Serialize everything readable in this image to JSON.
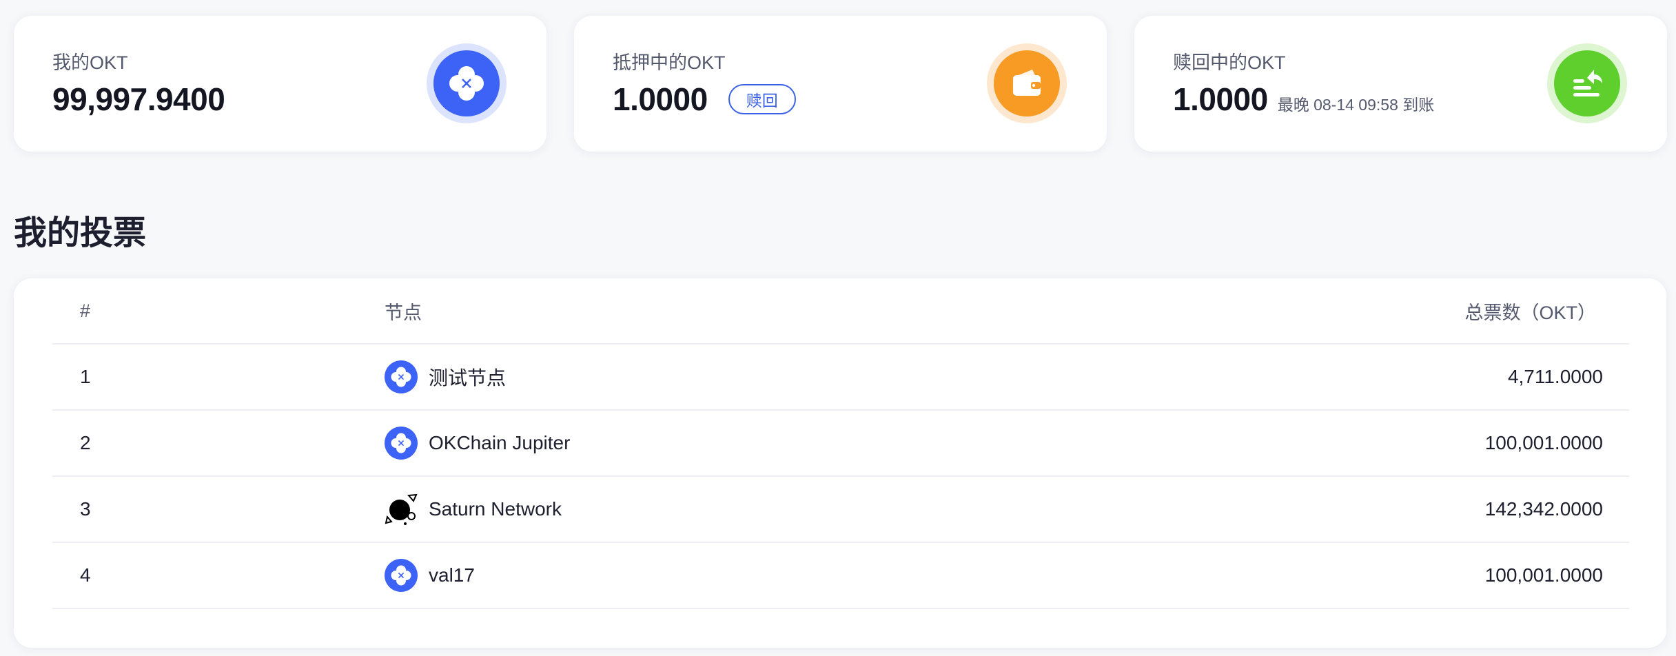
{
  "cards": {
    "my_okt": {
      "label": "我的OKT",
      "value": "99,997.9400",
      "icon": "okt-logo-icon",
      "icon_color": "#3d63f6"
    },
    "staked_okt": {
      "label": "抵押中的OKT",
      "value": "1.0000",
      "redeem_button": "赎回",
      "icon": "wallet-icon",
      "icon_color": "#f79b24"
    },
    "redeeming_okt": {
      "label": "赎回中的OKT",
      "value": "1.0000",
      "arrival_note": "最晚 08-14 09:58 到账",
      "icon": "redeem-return-icon",
      "icon_color": "#5fcf2e"
    }
  },
  "votes": {
    "title": "我的投票",
    "columns": {
      "index": "#",
      "node": "节点",
      "total": "总票数（OKT）"
    },
    "rows": [
      {
        "index": "1",
        "node": "测试节点",
        "total": "4,711.0000",
        "icon": "okt-logo-icon"
      },
      {
        "index": "2",
        "node": "OKChain Jupiter",
        "total": "100,001.0000",
        "icon": "okt-logo-icon"
      },
      {
        "index": "3",
        "node": "Saturn Network",
        "total": "142,342.0000",
        "icon": "saturn-logo-icon"
      },
      {
        "index": "4",
        "node": "val17",
        "total": "100,001.0000",
        "icon": "okt-logo-icon"
      }
    ]
  },
  "colors": {
    "accent_blue": "#3d63f6",
    "accent_orange": "#f79b24",
    "accent_green": "#5fcf2e"
  }
}
